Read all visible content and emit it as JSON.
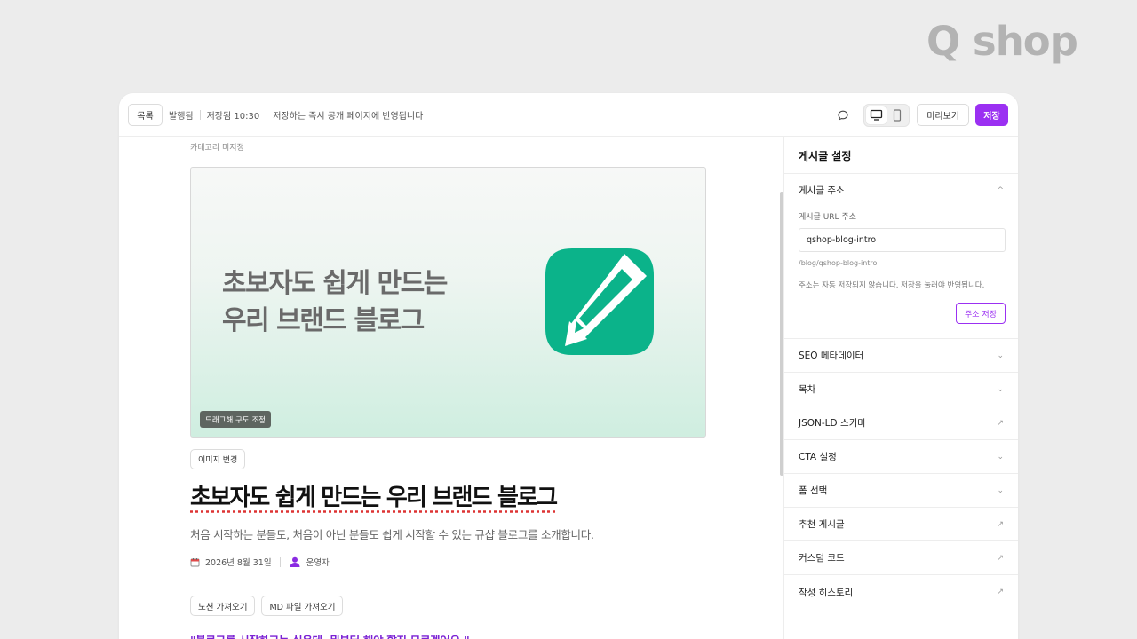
{
  "brand": {
    "logo_text": "Q shop"
  },
  "toolbar": {
    "list_label": "목록",
    "status_published": "발행됨",
    "status_saved": "저장됨 10:30",
    "status_note": "저장하는 즉시 공개 페이지에 반영됩니다",
    "preview_label": "미리보기",
    "save_label": "저장",
    "icons": [
      "comment-icon",
      "desktop-icon",
      "mobile-icon"
    ]
  },
  "editor": {
    "category_label": "카테고리 미지정",
    "hero": {
      "line1": "초보자도 쉽게 만드는",
      "line2": "우리 브랜드 블로그",
      "drag_hint": "드래그해 구도 조정"
    },
    "change_image_label": "이미지 변경",
    "title": "초보자도 쉽게 만드는 우리 브랜드 블로그",
    "subtitle": "처음 시작하는 분들도, 처음이 아닌 분들도 쉽게 시작할 수 있는 큐샵 블로그를 소개합니다.",
    "date": "2026년 8월 31일",
    "author": "운영자",
    "import_notion": "노션 가져오기",
    "import_md": "MD 파일 가져오기",
    "quote": "\"블로그를 시작하고는 싶은데, 뭐부터 해야 할지 모르겠어요.\""
  },
  "panel": {
    "title": "게시글 설정",
    "url_section": {
      "heading": "게시글 주소",
      "field_label": "게시글 URL 주소",
      "value": "qshop-blog-intro",
      "path_preview": "/blog/qshop-blog-intro",
      "helper": "주소는 자동 저장되지 않습니다. 저장을 눌러야 반영됩니다.",
      "save_label": "주소 저장"
    },
    "rows": [
      {
        "label": "SEO 메타데이터",
        "indicator": "⌄"
      },
      {
        "label": "목차",
        "indicator": "⌄"
      },
      {
        "label": "JSON-LD 스키마",
        "indicator": "↗"
      },
      {
        "label": "CTA 설정",
        "indicator": "⌄"
      },
      {
        "label": "폼 선택",
        "indicator": "⌄"
      },
      {
        "label": "추천 게시글",
        "indicator": "↗"
      },
      {
        "label": "커스텀 코드",
        "indicator": "↗"
      },
      {
        "label": "작성 히스토리",
        "indicator": "↗"
      }
    ]
  },
  "colors": {
    "accent": "#9b30f2",
    "logo_green": "#0bb38a",
    "hero_text": "#6a6a6a"
  }
}
